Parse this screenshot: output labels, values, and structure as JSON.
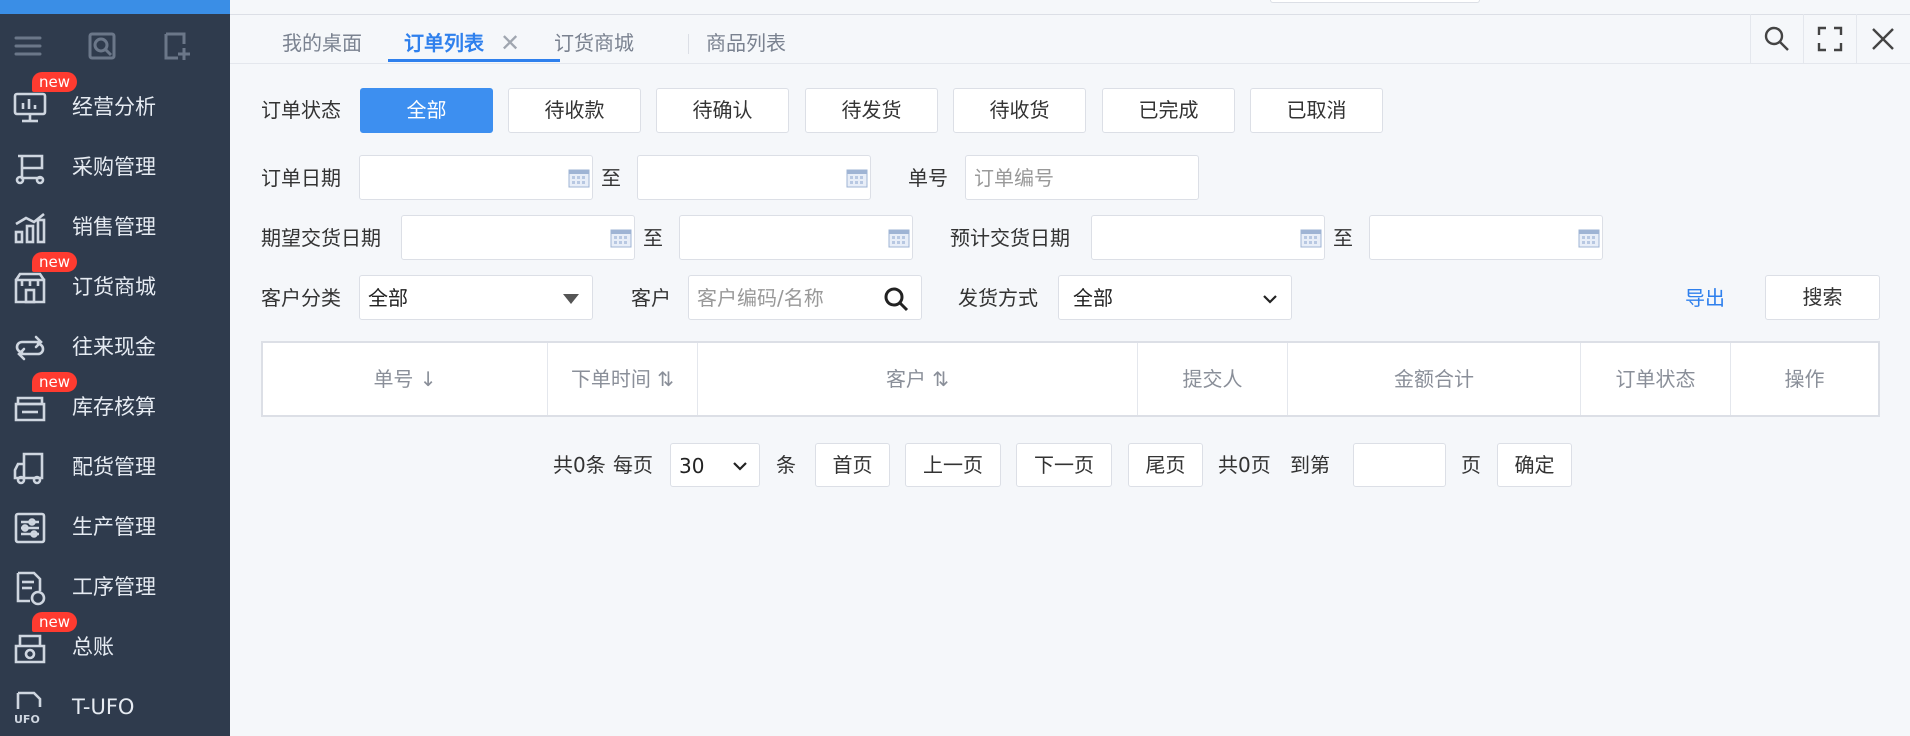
{
  "sidebar": {
    "items": [
      {
        "label": "经营分析",
        "icon": "monitor-chart-icon",
        "badge": "new"
      },
      {
        "label": "采购管理",
        "icon": "cart-icon",
        "badge": ""
      },
      {
        "label": "销售管理",
        "icon": "growth-chart-icon",
        "badge": ""
      },
      {
        "label": "订货商城",
        "icon": "store-icon",
        "badge": "new"
      },
      {
        "label": "往来现金",
        "icon": "exchange-arrows-icon",
        "badge": ""
      },
      {
        "label": "库存核算",
        "icon": "inventory-icon",
        "badge": "new"
      },
      {
        "label": "配货管理",
        "icon": "truck-icon",
        "badge": ""
      },
      {
        "label": "生产管理",
        "icon": "sliders-icon",
        "badge": ""
      },
      {
        "label": "工序管理",
        "icon": "process-doc-icon",
        "badge": ""
      },
      {
        "label": "总账",
        "icon": "ledger-icon",
        "badge": "new"
      },
      {
        "label": "T-UFO",
        "icon": "ufo-report-icon",
        "badge": ""
      }
    ]
  },
  "tabs": [
    {
      "label": "我的桌面"
    },
    {
      "label": "订单列表"
    },
    {
      "label": "订货商城"
    },
    {
      "label": "商品列表"
    }
  ],
  "filters": {
    "status_label": "订单状态",
    "status_options": [
      "全部",
      "待收款",
      "待确认",
      "待发货",
      "待收货",
      "已完成",
      "已取消"
    ],
    "order_date_label": "订单日期",
    "to_label": "至",
    "order_no_label": "单号",
    "order_no_placeholder": "订单编号",
    "expected_date_label": "期望交货日期",
    "planned_date_label": "预计交货日期",
    "customer_category_label": "客户分类",
    "customer_category_value": "全部",
    "customer_label": "客户",
    "customer_placeholder": "客户编码/名称",
    "shipping_label": "发货方式",
    "shipping_value": "全部",
    "export_label": "导出",
    "search_label": "搜索"
  },
  "table": {
    "columns": [
      "单号 ↓",
      "下单时间 ⇅",
      "客户 ⇅",
      "提交人",
      "金额合计",
      "订单状态",
      "操作"
    ]
  },
  "pagination": {
    "total": "共0条",
    "per_page_label": "每页",
    "per_page_value": "30",
    "unit": "条",
    "first": "首页",
    "prev": "上一页",
    "next": "下一页",
    "last": "尾页",
    "pages": "共0页",
    "goto_label": "到第",
    "page_unit": "页",
    "confirm": "确定"
  },
  "colors": {
    "accent": "#3d8ff0",
    "sidebar_bg": "#2f3b4d",
    "badge": "#ff3b30"
  }
}
